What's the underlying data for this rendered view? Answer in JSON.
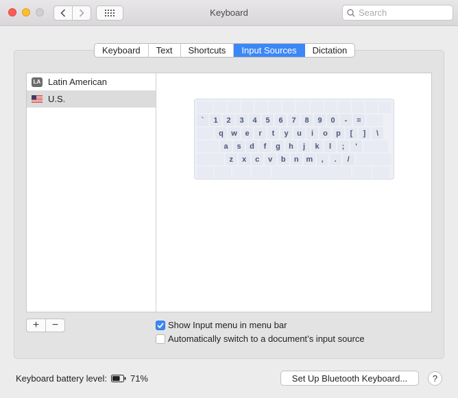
{
  "window": {
    "title": "Keyboard"
  },
  "search": {
    "placeholder": "Search"
  },
  "tabs": [
    {
      "label": "Keyboard"
    },
    {
      "label": "Text"
    },
    {
      "label": "Shortcuts"
    },
    {
      "label": "Input Sources",
      "active": true
    },
    {
      "label": "Dictation"
    }
  ],
  "sources": [
    {
      "label": "Latin American",
      "badge": "LA",
      "icon": "la-badge-icon"
    },
    {
      "label": "U.S.",
      "icon": "us-flag-icon",
      "selected": true
    }
  ],
  "keyboard": {
    "row1": [
      "`",
      "1",
      "2",
      "3",
      "4",
      "5",
      "6",
      "7",
      "8",
      "9",
      "0",
      "-",
      "="
    ],
    "row2": [
      "q",
      "w",
      "e",
      "r",
      "t",
      "y",
      "u",
      "i",
      "o",
      "p",
      "[",
      "]",
      "\\"
    ],
    "row3": [
      "a",
      "s",
      "d",
      "f",
      "g",
      "h",
      "j",
      "k",
      "l",
      ";",
      "'"
    ],
    "row4": [
      "z",
      "x",
      "c",
      "v",
      "b",
      "n",
      "m",
      ",",
      ".",
      "/"
    ]
  },
  "controls": {
    "add": "+",
    "remove": "−"
  },
  "options": {
    "show_input_menu": {
      "label": "Show Input menu in menu bar",
      "checked": true
    },
    "auto_switch": {
      "label": "Automatically switch to a document’s input source",
      "checked": false
    }
  },
  "footer": {
    "battery_label": "Keyboard battery level:",
    "battery_value": "71%",
    "battery_level": 0.71,
    "bluetooth_button": "Set Up Bluetooth Keyboard...",
    "help": "?"
  }
}
